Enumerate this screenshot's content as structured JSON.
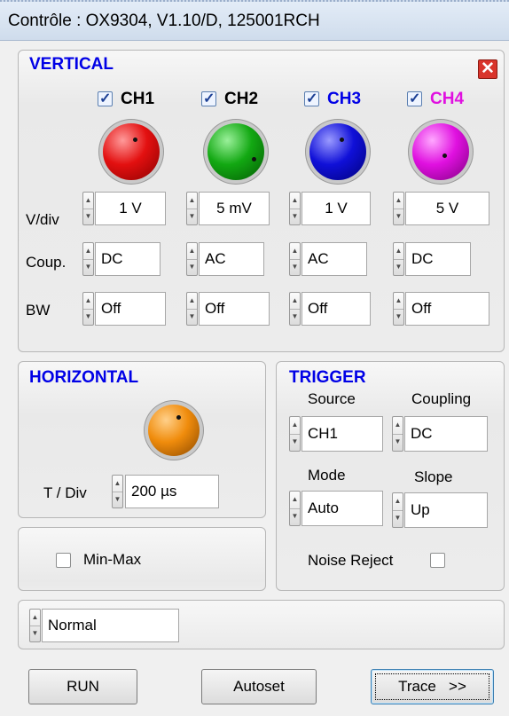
{
  "window": {
    "title": "Contrôle : OX9304, V1.10/D, 125001RCH"
  },
  "vertical": {
    "title": "VERTICAL",
    "close_glyph": "✕",
    "row_labels": {
      "vdiv": "V/div",
      "coup": "Coup.",
      "bw": "BW"
    },
    "channels": [
      {
        "name": "CH1",
        "checked": true,
        "color": "#000000",
        "knob_color": "#e31010",
        "vdiv": "1 V",
        "coupling": "DC",
        "bw": "Off"
      },
      {
        "name": "CH2",
        "checked": true,
        "color": "#000000",
        "knob_color": "#12a812",
        "vdiv": "5 mV",
        "coupling": "AC",
        "bw": "Off"
      },
      {
        "name": "CH3",
        "checked": true,
        "color": "#0000e6",
        "knob_color": "#1010d8",
        "vdiv": "1 V",
        "coupling": "AC",
        "bw": "Off"
      },
      {
        "name": "CH4",
        "checked": true,
        "color": "#e010e0",
        "knob_color": "#e010e0",
        "vdiv": "5 V",
        "coupling": "DC",
        "bw": "Off"
      }
    ]
  },
  "horizontal": {
    "title": "HORIZONTAL",
    "knob_color": "#f08c0c",
    "tdiv_label": "T / Div",
    "tdiv_value": "200 µs"
  },
  "minmax": {
    "label": "Min-Max",
    "checked": false
  },
  "trigger": {
    "title": "TRIGGER",
    "source_label": "Source",
    "source_value": "CH1",
    "coupling_label": "Coupling",
    "coupling_value": "DC",
    "mode_label": "Mode",
    "mode_value": "Auto",
    "slope_label": "Slope",
    "slope_value": "Up",
    "noise_label": "Noise Reject",
    "noise_checked": false
  },
  "acquisition": {
    "mode_value": "Normal"
  },
  "buttons": {
    "run": "RUN",
    "autoset": "Autoset",
    "trace": "Trace   >>"
  },
  "icons": {
    "spin_up": "▲",
    "spin_down": "▼"
  },
  "colors": {
    "section_title": "#0000e6",
    "close": "#d9342b"
  }
}
